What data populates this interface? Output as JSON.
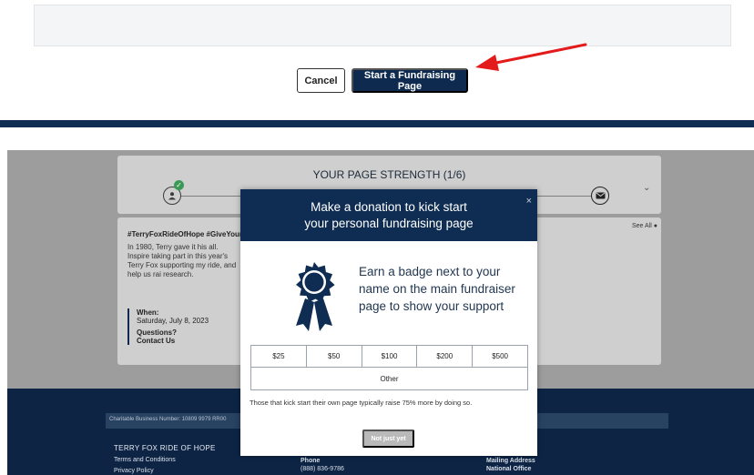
{
  "actions": {
    "cancel_label": "Cancel",
    "start_label": "Start a Fundraising Page"
  },
  "page_strength": {
    "title": "YOUR PAGE STRENGTH (1/6)"
  },
  "story": {
    "tags": "#TerryFoxRideOfHope #GiveYourA",
    "text": "In 1980, Terry gave it his all. Inspire taking part in this year's Terry Fox supporting my ride, and help us rai research.",
    "see_all": "See All",
    "when_label": "When:",
    "when_value": "Saturday, July 8, 2023",
    "questions_label": "Questions?",
    "contact_label": "Contact Us"
  },
  "footer": {
    "charitable_number": "Charitable Business Number: 10809 9979 RR00",
    "org_name": "TERRY FOX RIDE OF HOPE",
    "terms": "Terms and Conditions",
    "privacy": "Privacy Policy",
    "phone_label": "Phone",
    "phone_value": "(888) 836-9786",
    "mailing_label": "Mailing Address",
    "mailing_value": "National Office"
  },
  "modal": {
    "title_line1": "Make a donation to kick start",
    "title_line2": "your personal fundraising page",
    "close": "×",
    "badge_text": "Earn a badge next to your name on the main fundraiser page to show your support",
    "amounts": [
      "$25",
      "$50",
      "$100",
      "$200",
      "$500"
    ],
    "other": "Other",
    "note": "Those that kick start their own page typically raise 75% more by doing so.",
    "not_yet": "Not just yet"
  },
  "colors": {
    "brand_navy": "#0f2d52",
    "arrow_red": "#e31b1b",
    "check_green": "#3a9a55"
  }
}
